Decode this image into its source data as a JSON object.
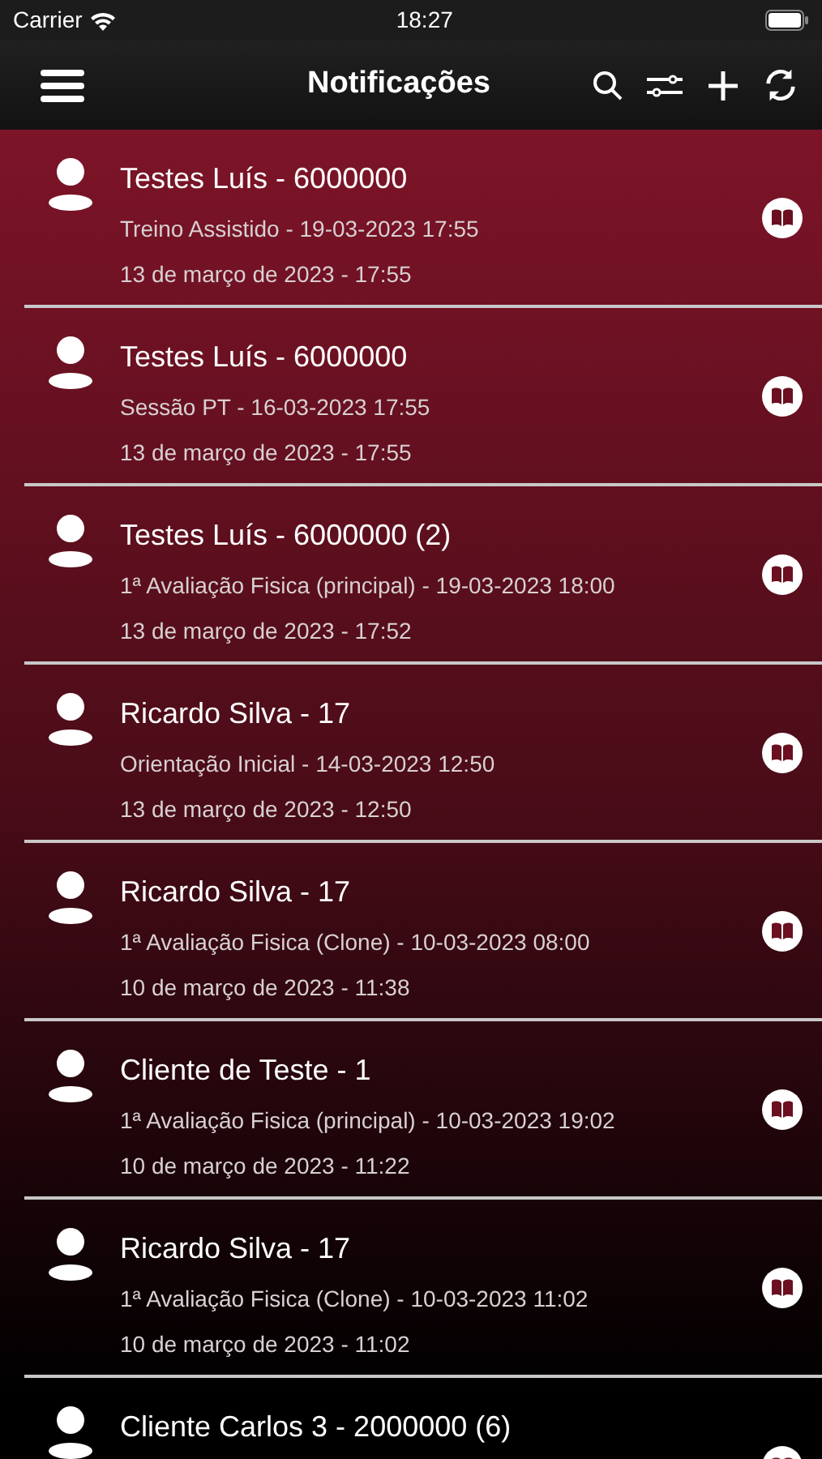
{
  "status_bar": {
    "carrier": "Carrier",
    "time": "18:27"
  },
  "nav": {
    "title": "Notificações"
  },
  "notifications": [
    {
      "title": "Testes Luís - 6000000",
      "subtitle": "Treino Assistido - 19-03-2023 17:55",
      "date": "13 de março de 2023 - 17:55"
    },
    {
      "title": "Testes Luís - 6000000",
      "subtitle": "Sessão PT - 16-03-2023 17:55",
      "date": "13 de março de 2023 - 17:55"
    },
    {
      "title": "Testes Luís - 6000000 (2)",
      "subtitle": "1ª Avaliação Fisica (principal) - 19-03-2023 18:00",
      "date": "13 de março de 2023 - 17:52"
    },
    {
      "title": "Ricardo Silva - 17",
      "subtitle": "Orientação Inicial - 14-03-2023 12:50",
      "date": "13 de março de 2023 - 12:50"
    },
    {
      "title": "Ricardo Silva - 17",
      "subtitle": "1ª Avaliação Fisica (Clone) - 10-03-2023 08:00",
      "date": "10 de março de 2023 - 11:38"
    },
    {
      "title": "Cliente de Teste - 1",
      "subtitle": "1ª Avaliação Fisica (principal) - 10-03-2023 19:02",
      "date": "10 de março de 2023 - 11:22"
    },
    {
      "title": "Ricardo Silva - 17",
      "subtitle": "1ª Avaliação Fisica (Clone) - 10-03-2023 11:02",
      "date": "10 de março de 2023 - 11:02"
    },
    {
      "title": "Cliente Carlos 3 - 2000000 (6)"
    }
  ]
}
